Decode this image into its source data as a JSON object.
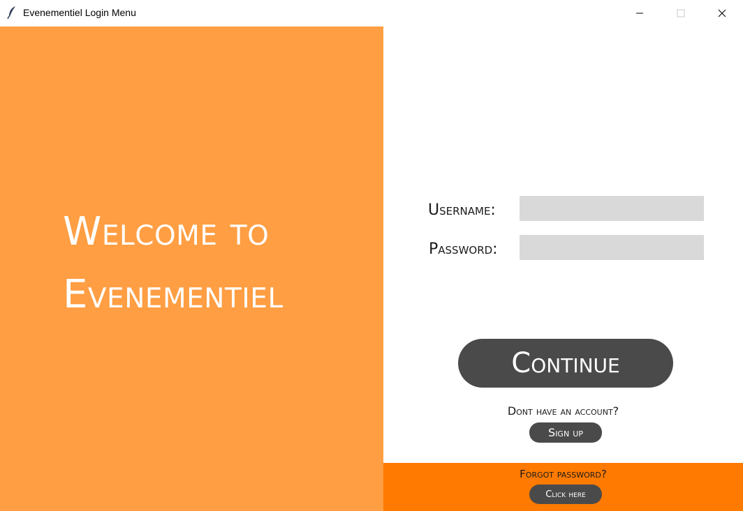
{
  "window": {
    "title": "Evenementiel Login Menu",
    "icon": "feather-icon"
  },
  "welcome": {
    "line1": "Welcome to",
    "line2": "Evenementiel"
  },
  "form": {
    "username_label": "Username:",
    "password_label": "Password:",
    "username_value": "",
    "password_value": ""
  },
  "actions": {
    "continue_label": "Continue",
    "no_account_text": "Dont have an account?",
    "signup_label": "Sign up",
    "forgot_text": "Forgot password?",
    "click_here_label": "Click here"
  },
  "colors": {
    "left_panel": "#ff9e43",
    "bottom_bar": "#ff7a00",
    "button": "#4a4a4a",
    "field": "#d9d9d9"
  }
}
